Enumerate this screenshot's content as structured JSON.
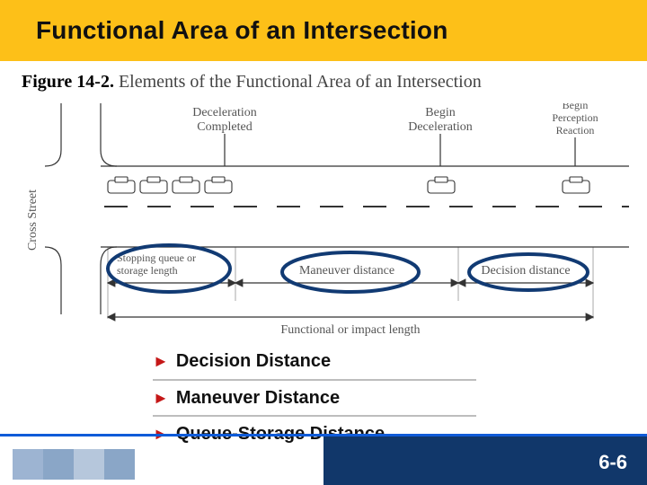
{
  "title": "Functional Area of an Intersection",
  "figure_number": "Figure 14-2.",
  "figure_caption": "Elements of the Functional Area of an Intersection",
  "diagram": {
    "cross_street_label": "Cross Street",
    "callouts": {
      "decel_completed_l1": "Deceleration",
      "decel_completed_l2": "Completed",
      "begin_decel_l1": "Begin",
      "begin_decel_l2": "Deceleration",
      "begin_pr_l1": "Begin",
      "begin_pr_l2": "Perception",
      "begin_pr_l3": "Reaction"
    },
    "segments": {
      "stopping_l1": "Stopping queue or",
      "stopping_l2": "storage length",
      "maneuver": "Maneuver distance",
      "decision": "Decision distance"
    },
    "functional_label": "Functional or impact length"
  },
  "bullets": [
    "Decision Distance",
    "Maneuver Distance",
    "Queue-Storage Distance"
  ],
  "page_number": "6-6"
}
